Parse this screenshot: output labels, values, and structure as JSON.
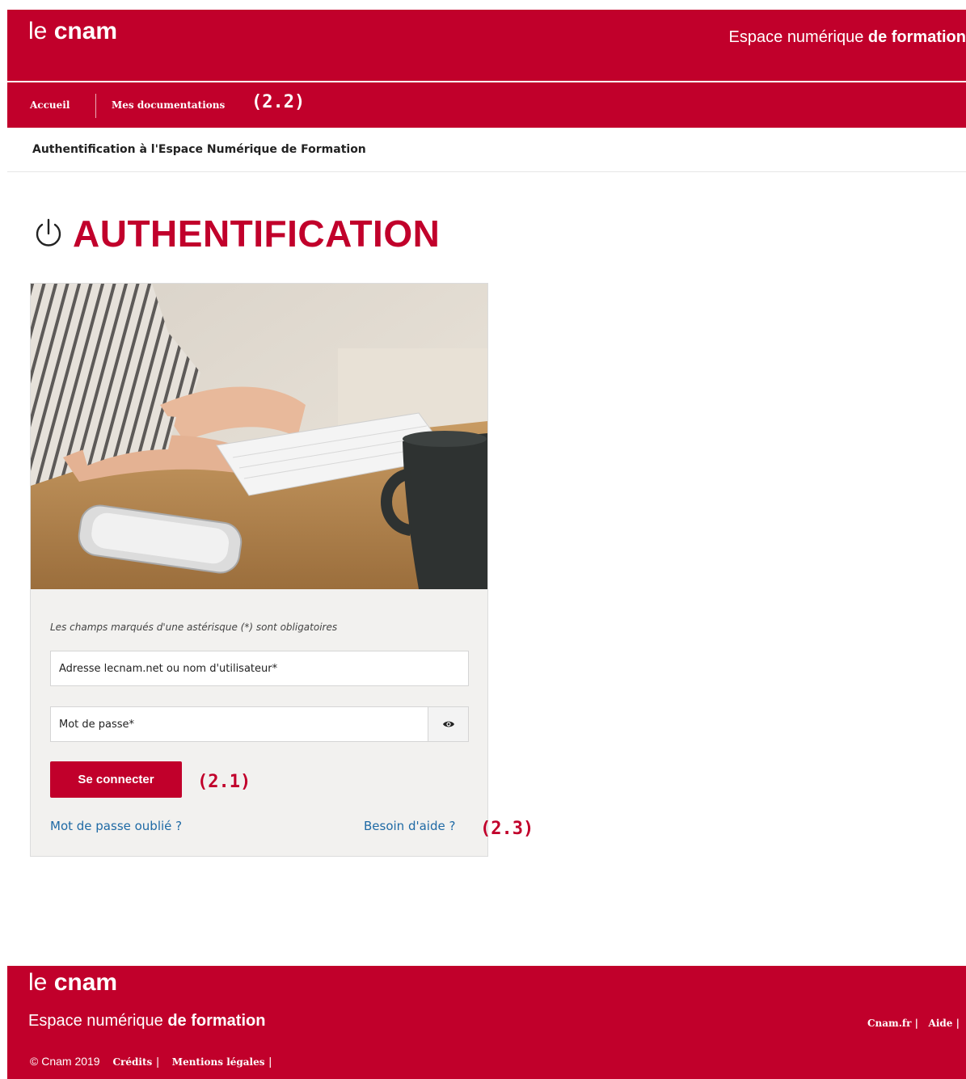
{
  "header": {
    "logo_le": "le ",
    "logo_cnam": "cnam",
    "title_light": "Espace numérique ",
    "title_bold": "de formation"
  },
  "nav": {
    "items": [
      {
        "label": "Accueil"
      },
      {
        "label": "Mes documentations"
      }
    ],
    "annotation": "(2.2)"
  },
  "breadcrumb": "Authentification à l'Espace Numérique de Formation",
  "page": {
    "title": "AUTHENTIFICATION"
  },
  "form": {
    "hint": "Les champs marqués d'une astérisque (*) sont obligatoires",
    "username_placeholder": "Adresse lecnam.net ou nom d'utilisateur*",
    "password_placeholder": "Mot de passe*",
    "submit_label": "Se connecter",
    "submit_annotation": "(2.1)",
    "forgot_label": "Mot de passe oublié ?",
    "help_label": "Besoin d'aide ?",
    "help_annotation": "(2.3)"
  },
  "footer": {
    "logo_le": "le ",
    "logo_cnam": "cnam",
    "title_light": "Espace numérique ",
    "title_bold": "de formation",
    "copyright": "© Cnam 2019",
    "links_left": [
      "Crédits",
      "Mentions légales"
    ],
    "links_right": [
      "Cnam.fr",
      "Aide"
    ],
    "separator": "|"
  },
  "colors": {
    "brand": "#c1002b",
    "link": "#1f6aa5",
    "card_bg": "#f2f1ef"
  }
}
